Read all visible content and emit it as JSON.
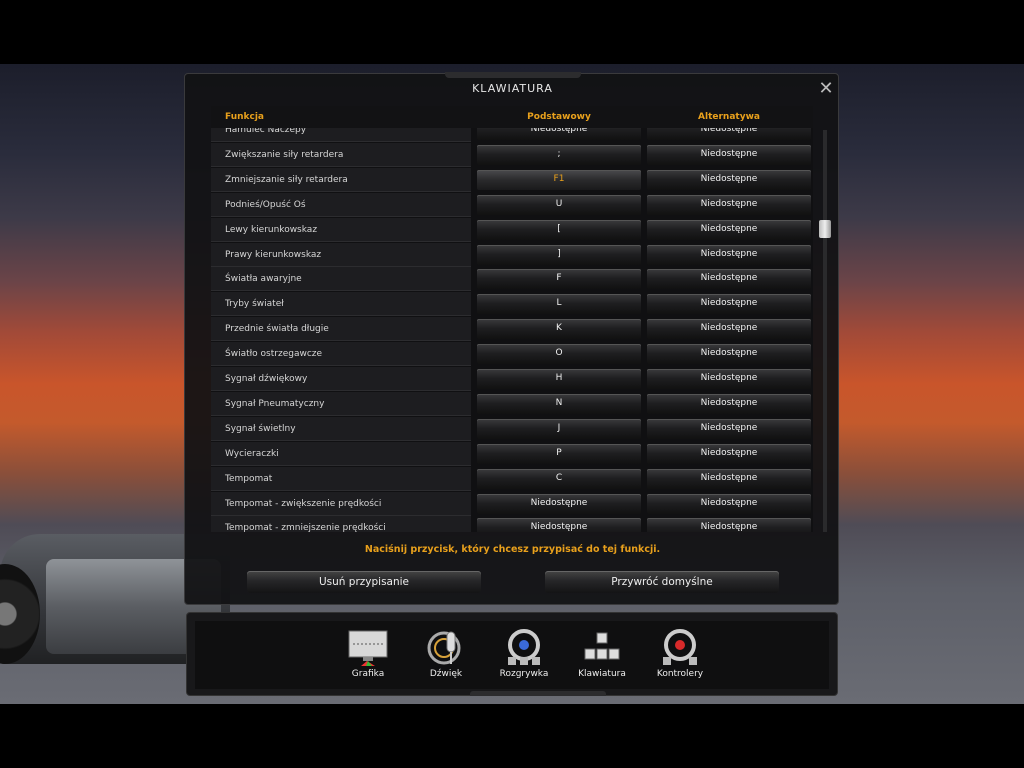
{
  "window": {
    "title": "KLAWIATURA",
    "close_icon": "✕"
  },
  "grid": {
    "headers": {
      "function": "Funkcja",
      "primary": "Podstawowy",
      "alternative": "Alternatywa"
    },
    "rows": [
      {
        "function": "Hamulec Naczepy",
        "primary": "Niedostępne",
        "alternative": "Niedostępne"
      },
      {
        "function": "Zwiększanie siły retardera",
        "primary": ";",
        "alternative": "Niedostępne"
      },
      {
        "function": "Zmniejszanie siły retardera",
        "primary": "F1",
        "alternative": "Niedostępne",
        "selected": true
      },
      {
        "function": "Podnieś/Opuść Oś",
        "primary": "U",
        "alternative": "Niedostępne"
      },
      {
        "function": "Lewy kierunkowskaz",
        "primary": "[",
        "alternative": "Niedostępne"
      },
      {
        "function": "Prawy kierunkowskaz",
        "primary": "]",
        "alternative": "Niedostępne"
      },
      {
        "function": "Światła awaryjne",
        "primary": "F",
        "alternative": "Niedostępne"
      },
      {
        "function": "Tryby świateł",
        "primary": "L",
        "alternative": "Niedostępne"
      },
      {
        "function": "Przednie światła długie",
        "primary": "K",
        "alternative": "Niedostępne"
      },
      {
        "function": "Światło ostrzegawcze",
        "primary": "O",
        "alternative": "Niedostępne"
      },
      {
        "function": "Sygnał dźwiękowy",
        "primary": "H",
        "alternative": "Niedostępne"
      },
      {
        "function": "Sygnał Pneumatyczny",
        "primary": "N",
        "alternative": "Niedostępne"
      },
      {
        "function": "Sygnał świetlny",
        "primary": "J",
        "alternative": "Niedostępne"
      },
      {
        "function": "Wycieraczki",
        "primary": "P",
        "alternative": "Niedostępne"
      },
      {
        "function": "Tempomat",
        "primary": "C",
        "alternative": "Niedostępne"
      },
      {
        "function": "Tempomat - zwiększenie prędkości",
        "primary": "Niedostępne",
        "alternative": "Niedostępne"
      },
      {
        "function": "Tempomat - zmniejszenie prędkości",
        "primary": "Niedostępne",
        "alternative": "Niedostępne"
      }
    ]
  },
  "prompt": "Naciśnij przycisk, który chcesz przypisać do tej funkcji.",
  "buttons": {
    "clear": "Usuń przypisanie",
    "restore_defaults": "Przywróć domyślne"
  },
  "nav": [
    {
      "label": "Grafika",
      "icon": "monitor-icon"
    },
    {
      "label": "Dźwięk",
      "icon": "microphone-icon"
    },
    {
      "label": "Rozgrywka",
      "icon": "steering-wheel-icon"
    },
    {
      "label": "Klawiatura",
      "icon": "keyboard-keys-icon"
    },
    {
      "label": "Kontrolery",
      "icon": "controller-wheel-icon"
    }
  ],
  "colors": {
    "accent": "#e8a01c",
    "panel": "#121214"
  }
}
